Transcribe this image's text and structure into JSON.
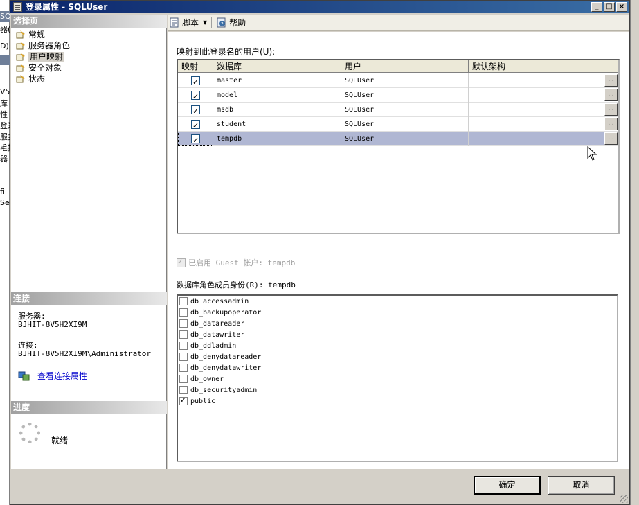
{
  "window": {
    "title": "登录属性 - SQLUser",
    "controls": [
      "_",
      "□",
      "×"
    ]
  },
  "background": {
    "fragments": [
      "SQ",
      "器(",
      "D)",
      "V5",
      "库",
      "性",
      "登录",
      "服务",
      "毛拥",
      "器",
      "fi",
      "Se"
    ]
  },
  "sidebar": {
    "pages_header": "选择页",
    "pages": [
      {
        "label": "常规"
      },
      {
        "label": "服务器角色"
      },
      {
        "label": "用户映射",
        "selected": true
      },
      {
        "label": "安全对象"
      },
      {
        "label": "状态"
      }
    ],
    "connection_header": "连接",
    "server_label": "服务器:",
    "server_value": "BJHIT-8V5H2XI9M",
    "connection_label": "连接:",
    "connection_value": "BJHIT-8V5H2XI9M\\Administrator",
    "view_connection_link": "查看连接属性",
    "progress_header": "进度",
    "progress_status": "就绪"
  },
  "toolbar": {
    "script_label": "脚本",
    "help_label": "帮助"
  },
  "mapping": {
    "label": "映射到此登录名的用户(U):",
    "columns": [
      "映射",
      "数据库",
      "用户",
      "默认架构"
    ],
    "rows": [
      {
        "mapped": true,
        "database": "master",
        "user": "SQLUser",
        "schema": "",
        "selected": false
      },
      {
        "mapped": true,
        "database": "model",
        "user": "SQLUser",
        "schema": "",
        "selected": false
      },
      {
        "mapped": true,
        "database": "msdb",
        "user": "SQLUser",
        "schema": "",
        "selected": false
      },
      {
        "mapped": true,
        "database": "student",
        "user": "SQLUser",
        "schema": "",
        "selected": false
      },
      {
        "mapped": true,
        "database": "tempdb",
        "user": "SQLUser",
        "schema": "",
        "selected": true
      }
    ],
    "ellipsis": "..."
  },
  "guest": {
    "label": "已启用 Guest 帐户: tempdb",
    "checked": true,
    "disabled": true
  },
  "roles": {
    "label": "数据库角色成员身份(R): tempdb",
    "items": [
      {
        "name": "db_accessadmin",
        "checked": false
      },
      {
        "name": "db_backupoperator",
        "checked": false
      },
      {
        "name": "db_datareader",
        "checked": false
      },
      {
        "name": "db_datawriter",
        "checked": false
      },
      {
        "name": "db_ddladmin",
        "checked": false
      },
      {
        "name": "db_denydatareader",
        "checked": false
      },
      {
        "name": "db_denydatawriter",
        "checked": false
      },
      {
        "name": "db_owner",
        "checked": false
      },
      {
        "name": "db_securityadmin",
        "checked": false
      },
      {
        "name": "public",
        "checked": true
      }
    ]
  },
  "buttons": {
    "ok": "确定",
    "cancel": "取消"
  },
  "colors": {
    "title_start": "#0a246a",
    "title_end": "#3a6ea5",
    "selected_row": "#b0b7d3",
    "link": "#0000cc"
  }
}
